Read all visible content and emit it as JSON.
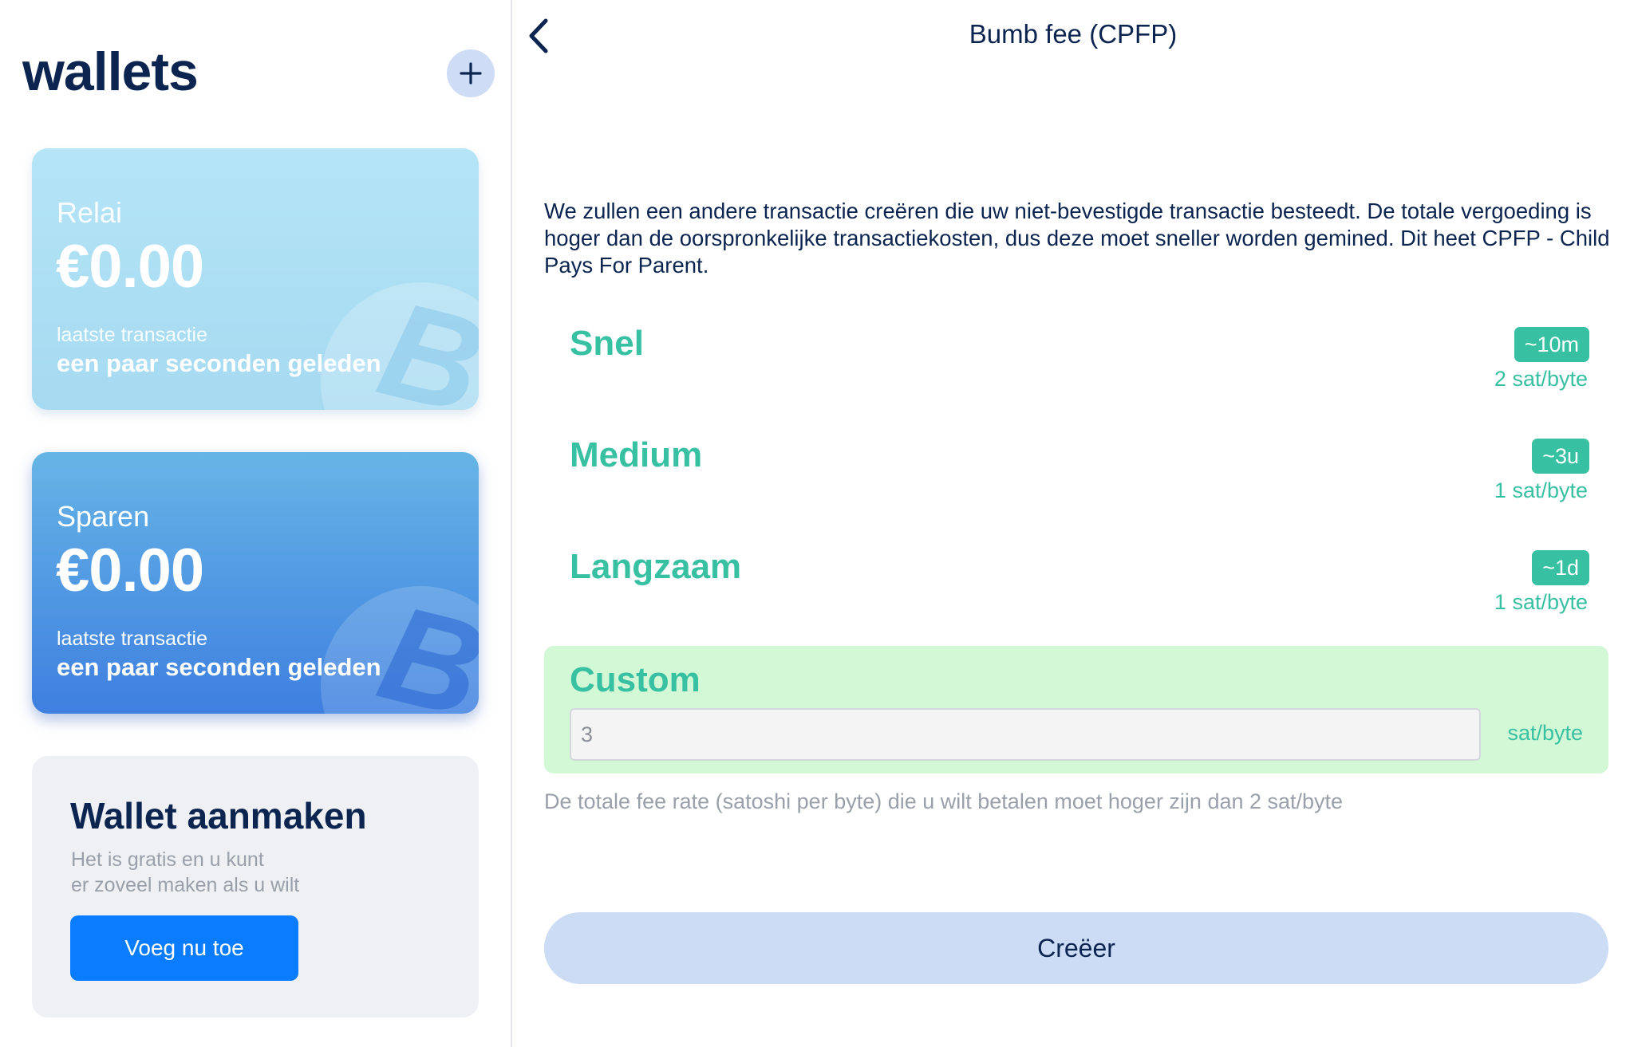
{
  "sidebar": {
    "title": "wallets",
    "add_icon": "plus-icon",
    "wallets": [
      {
        "name": "Relai",
        "balance": "€0.00",
        "latest_label": "laatste transactie",
        "latest_value": "een paar seconden geleden",
        "background_icon": "bitcoin-coin-icon",
        "colors": {
          "top": "#b4e4f6",
          "bottom": "#a6daf1"
        }
      },
      {
        "name": "Sparen",
        "balance": "€0.00",
        "latest_label": "laatste transactie",
        "latest_value": "een paar seconden geleden",
        "background_icon": "bitcoin-coin-icon",
        "colors": {
          "top": "#66b5e6",
          "bottom": "#3e7fe0"
        }
      }
    ],
    "create_card": {
      "title": "Wallet aanmaken",
      "desc_line1": "Het is gratis en u kunt",
      "desc_line2": "er zoveel maken als u wilt",
      "button_label": "Voeg nu toe"
    }
  },
  "header": {
    "back_icon": "chevron-left-icon",
    "title": "Bumb fee (CPFP)"
  },
  "main": {
    "intro": "We zullen een andere transactie creëren die uw niet-bevestigde transactie besteedt. De totale vergoeding is hoger dan de oorspronkelijke transactiekosten, dus deze moet sneller worden gemined. Dit heet CPFP - Child Pays For Parent.",
    "fee_options": [
      {
        "label": "Snel",
        "time": "~10m",
        "rate": "2 sat/byte"
      },
      {
        "label": "Medium",
        "time": "~3u",
        "rate": "1 sat/byte"
      },
      {
        "label": "Langzaam",
        "time": "~1d",
        "rate": "1 sat/byte"
      }
    ],
    "custom": {
      "label": "Custom",
      "value": "3",
      "unit": "sat/byte",
      "selected": true
    },
    "hint": "De totale fee rate (satoshi per byte) die u wilt betalen moet hoger zijn dan 2 sat/byte",
    "create_button": "Creëer"
  },
  "colors": {
    "accent_green": "#37c0a1",
    "custom_selected_bg": "#d2f8d6",
    "primary_blue": "#0a7cff",
    "navy_text": "#0c2550",
    "create_button_bg": "#ccdcf5"
  }
}
